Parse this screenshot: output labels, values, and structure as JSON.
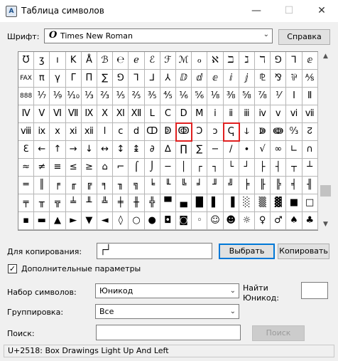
{
  "window": {
    "title": "Таблица символов",
    "icon_label": "A",
    "minimize_glyph": "—",
    "maximize_glyph": "☐",
    "close_glyph": "✕"
  },
  "font": {
    "label": "Шрифт:",
    "icon_glyph": "O",
    "value": "Times New Roman",
    "help_label": "Справка"
  },
  "grid": {
    "columns": 19,
    "selected": [
      [
        4,
        10
      ],
      [
        4,
        13
      ]
    ],
    "rows": [
      [
        "Ʊ",
        "ʒ",
        "ı",
        "K",
        "Å",
        "ℬ",
        "℮",
        "ℯ",
        "ℰ",
        "ℱ",
        "ℳ",
        "ℴ",
        "ℵ",
        "ℶ",
        "ℷ",
        "ℸ",
        "⅁",
        "⅂",
        "ⅇ"
      ],
      [
        "FAX",
        "π",
        "γ",
        "Γ",
        "Π",
        "∑",
        "⅁",
        "⅂",
        "⅃",
        "⅄",
        "ⅅ",
        "ⅆ",
        "ⅇ",
        "ⅈ",
        "ⅉ",
        "⅊",
        "⅋",
        "⅌",
        "⅍"
      ],
      [
        "888",
        "⅐",
        "⅑",
        "⅒",
        "⅓",
        "⅔",
        "⅕",
        "⅖",
        "⅗",
        "⅘",
        "⅙",
        "⅚",
        "⅛",
        "⅜",
        "⅝",
        "⅞",
        "⅟",
        "Ⅰ",
        "Ⅱ"
      ],
      [
        "Ⅳ",
        "Ⅴ",
        "Ⅵ",
        "Ⅶ",
        "Ⅸ",
        "Ⅹ",
        "Ⅺ",
        "Ⅻ",
        "Ⅼ",
        "Ⅽ",
        "Ⅾ",
        "Ⅿ",
        "ⅰ",
        "ⅱ",
        "ⅲ",
        "ⅳ",
        "ⅴ",
        "ⅵ",
        "ⅶ"
      ],
      [
        "ⅷ",
        "ⅸ",
        "ⅹ",
        "ⅺ",
        "ⅻ",
        "ⅼ",
        "ⅽ",
        "ⅾ",
        "ↀ",
        "ↁ",
        "ↂ",
        "Ↄ",
        "ↄ",
        "ↅ",
        "ↆ",
        "ↇ",
        "ↈ",
        "↉",
        "↊"
      ],
      [
        "ℇ",
        "←",
        "↑",
        "→",
        "↓",
        "↔",
        "↕",
        "↨",
        "∂",
        "∆",
        "∏",
        "∑",
        "−",
        "∕",
        "∙",
        "√",
        "∞",
        "∟",
        "∩"
      ],
      [
        "≈",
        "≠",
        "≡",
        "≤",
        "≥",
        "⌂",
        "⌐",
        "⌠",
        "⌡",
        "─",
        "│",
        "┌",
        "┐",
        "└",
        "┘",
        "├",
        "┤",
        "┬",
        "┴"
      ],
      [
        "═",
        "║",
        "╒",
        "╓",
        "╔",
        "╕",
        "╖",
        "╗",
        "╘",
        "╙",
        "╚",
        "╛",
        "╜",
        "╝",
        "╞",
        "╟",
        "╠",
        "╡",
        "╢"
      ],
      [
        "╤",
        "╥",
        "╦",
        "╧",
        "╨",
        "╩",
        "╪",
        "╫",
        "╬",
        "▀",
        "▄",
        "█",
        "▌",
        "▐",
        "░",
        "▒",
        "▓",
        "■",
        "□"
      ],
      [
        "▪",
        "▬",
        "▲",
        "►",
        "▼",
        "◄",
        "◊",
        "○",
        "●",
        "◘",
        "◙",
        "◦",
        "☺",
        "☻",
        "☼",
        "♀",
        "♂",
        "♠",
        "♣"
      ]
    ]
  },
  "copy": {
    "label": "Для копирования:",
    "value": "┌┘",
    "select_label": "Выбрать",
    "copy_label": "Копировать"
  },
  "advanced": {
    "checked": true,
    "check_glyph": "✓",
    "label": "Дополнительные параметры"
  },
  "charset": {
    "label": "Набор символов:",
    "value": "Юникод",
    "arrow_glyph": "⌄"
  },
  "find_unicode": {
    "label": "Найти Юникод:",
    "value": ""
  },
  "grouping": {
    "label": "Группировка:",
    "value": "Все",
    "arrow_glyph": "⌄"
  },
  "search": {
    "label": "Поиск:",
    "value": "",
    "button_label": "Поиск"
  },
  "status": {
    "text": "U+2518: Box Drawings Light Up And Left"
  },
  "scrollbar": {
    "up_glyph": "▲",
    "down_glyph": "▼"
  }
}
